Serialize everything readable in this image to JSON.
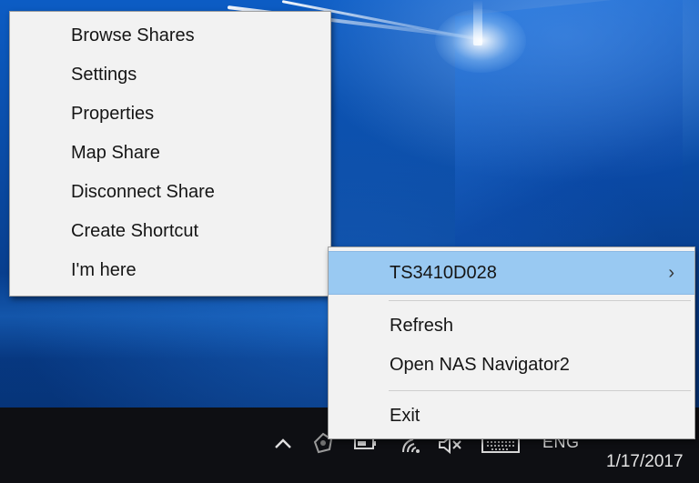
{
  "context_menu": {
    "items": [
      {
        "label": "Browse Shares"
      },
      {
        "label": "Settings"
      },
      {
        "label": "Properties"
      },
      {
        "label": "Map Share"
      },
      {
        "label": "Disconnect Share"
      },
      {
        "label": "Create Shortcut"
      },
      {
        "label": "I'm here"
      }
    ]
  },
  "tray_menu": {
    "device": {
      "label": "TS3410D028",
      "chevron": "›"
    },
    "refresh_label": "Refresh",
    "open_label": "Open NAS Navigator2",
    "exit_label": "Exit"
  },
  "taskbar": {
    "language": "ENG",
    "clock": "1/17/2017",
    "icons": [
      "chevron-up-icon",
      "nas-navigator-icon",
      "battery-icon",
      "wifi-icon",
      "volume-muted-icon",
      "keyboard-icon"
    ]
  },
  "colors": {
    "highlight": "#99c9f2",
    "menu_background": "#f2f2f2",
    "taskbar": "#0e0f13"
  }
}
